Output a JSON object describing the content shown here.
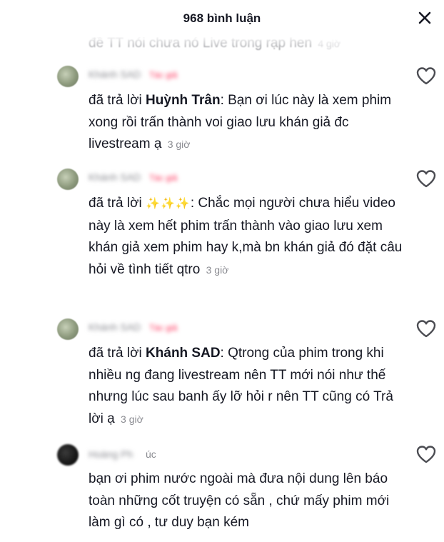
{
  "header": {
    "title": "968 bình luận",
    "close_icon": "close-icon"
  },
  "partial_top": {
    "text": "đề TT nói chưa nó Live trong rạp hen",
    "time": "4 giờ"
  },
  "comments": [
    {
      "author_blurred": "Khánh SAD",
      "author_tag": "Tác giả",
      "reply_prefix": "đã trả lời ",
      "reply_to": "Huỳnh Trân",
      "text": ": Bạn ơi lúc này là xem phim xong rồi trấn thành voi giao lưu khán giả đc livestream ạ",
      "time": "3 giờ"
    },
    {
      "author_blurred": "Khánh SAD",
      "author_tag": "Tác giả",
      "reply_prefix": "đã trả lời ",
      "reply_to": "✨✨✨",
      "text": ": Chắc mọi người chưa hiểu video này là xem hết phim trấn thành vào giao lưu xem khán giả xem phim hay k,mà bn khán giả đó đặt câu hỏi về tình tiết qtro",
      "time": "3 giờ"
    },
    {
      "author_blurred": "Khánh SAD",
      "author_tag": "Tác giả",
      "reply_prefix": "đã trả lời ",
      "reply_to": "Khánh SAD",
      "text": ": Qtrong của phim trong khi nhiều ng đang livestream nên TT mới nói như thế nhưng lúc sau banh ấy lỡ hỏi r nên TT cũng có Trả lời ạ",
      "time": "3 giờ"
    },
    {
      "author_blurred": "Hoàng Ph",
      "author_visible": "úc",
      "text": "bạn ơi phim nước ngoài mà đưa nội dung lên báo toàn những cốt truyện có sẵn , chứ mấy phim mới làm gì có , tư duy bạn kém"
    }
  ],
  "icons": {
    "like": "heart-outline-icon"
  },
  "colors": {
    "text": "#161823",
    "muted": "#8a8b91",
    "author_tag": "#fe2c55"
  }
}
